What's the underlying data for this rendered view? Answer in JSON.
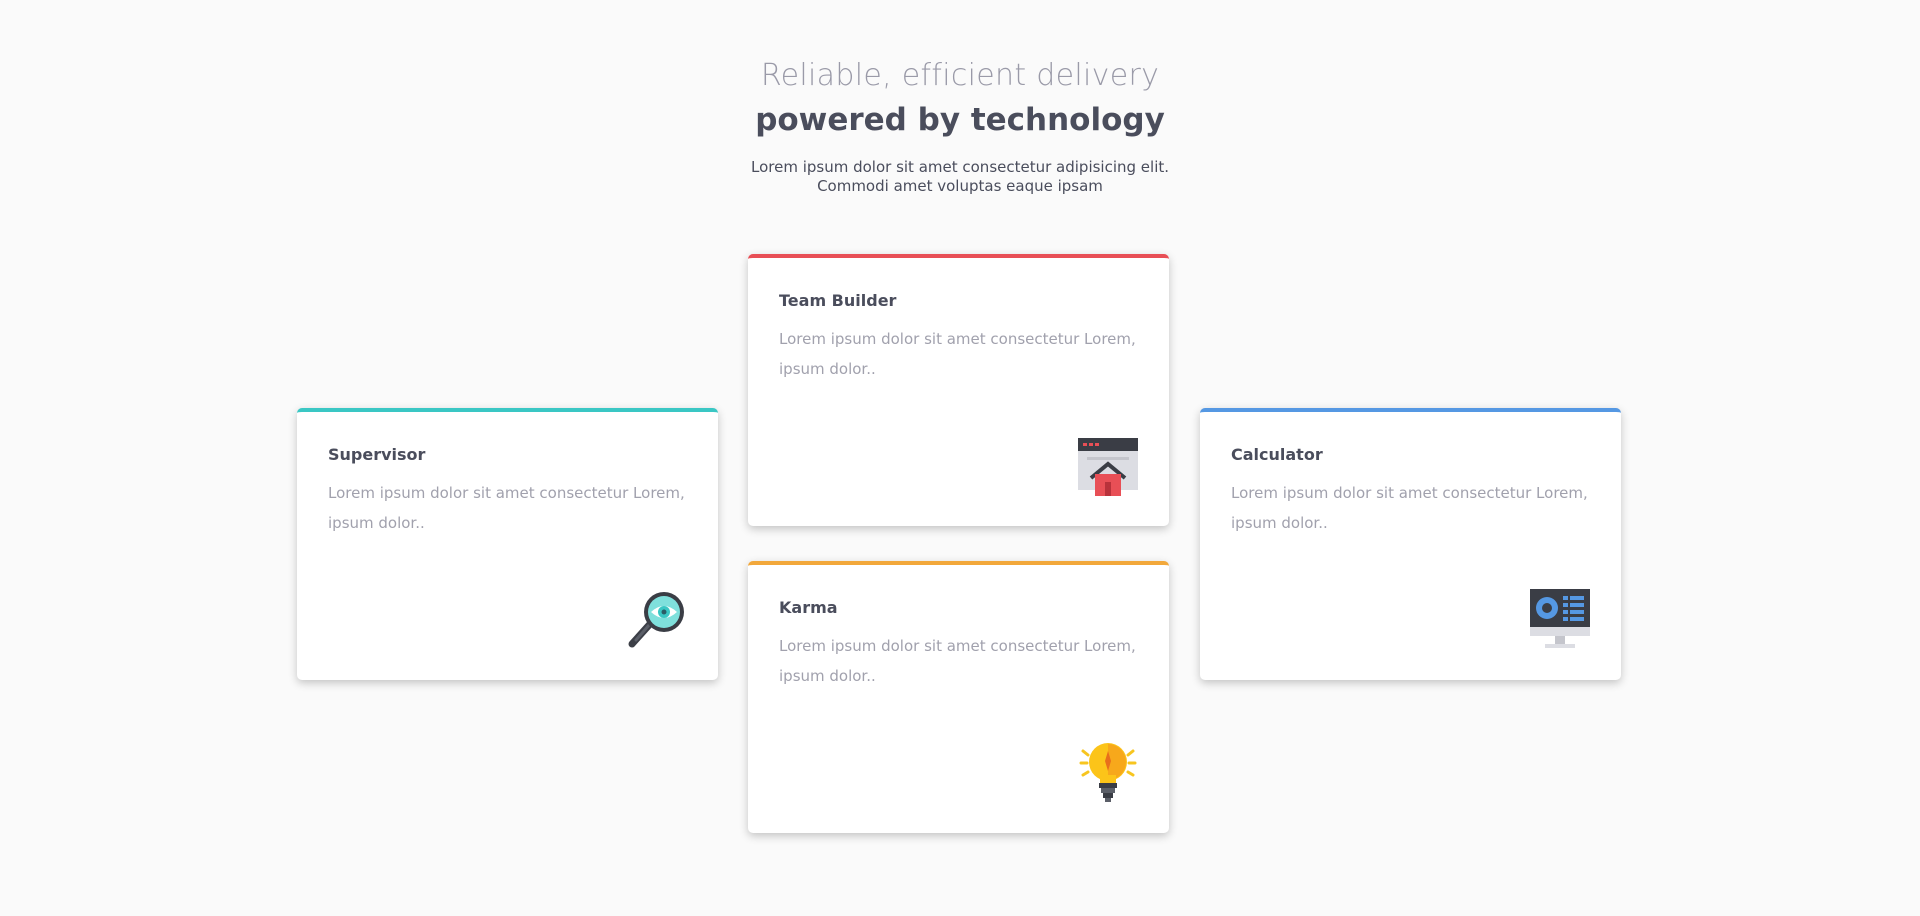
{
  "header": {
    "subtitle": "Reliable, efficient delivery",
    "title": "powered by technology",
    "description": "Lorem ipsum dolor sit amet consectetur adipisicing elit. Commodi amet voluptas eaque ipsam"
  },
  "cards": [
    {
      "title": "Supervisor",
      "body": "Lorem ipsum dolor sit amet consectetur Lorem, ipsum dolor..",
      "accent": "#3ac7c4",
      "icon": "magnifier-eye-icon"
    },
    {
      "title": "Team Builder",
      "body": "Lorem ipsum dolor sit amet consectetur Lorem, ipsum dolor..",
      "accent": "#e84f56",
      "icon": "browser-home-icon"
    },
    {
      "title": "Karma",
      "body": "Lorem ipsum dolor sit amet consectetur Lorem, ipsum dolor..",
      "accent": "#f2a83b",
      "icon": "lightbulb-icon"
    },
    {
      "title": "Calculator",
      "body": "Lorem ipsum dolor sit amet consectetur Lorem, ipsum dolor..",
      "accent": "#5598e3",
      "icon": "monitor-dashboard-icon"
    }
  ]
}
